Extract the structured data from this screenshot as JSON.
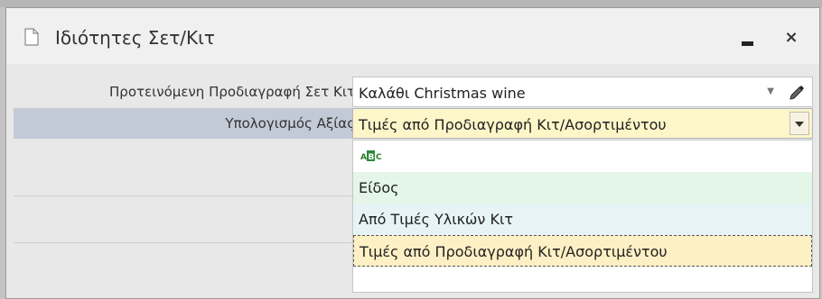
{
  "window": {
    "title": "Ιδιότητες Σετ/Κιτ",
    "close_glyph": "×"
  },
  "form": {
    "spec_label": "Προτεινόμενη Προδιαγραφή Σετ Κιτ",
    "spec_value": "Καλάθι Christmas wine",
    "value_calc_label": "Υπολογισμός Αξίας",
    "value_calc_value": "Τιμές από Προδιαγραφή Κιτ/Ασορτιμέντου"
  },
  "dropdown": {
    "search_icon_letters": "ABC",
    "options": [
      "Είδος",
      "Από Τιμές Υλικών Κιτ",
      "Τιμές από Προδιαγραφή Κιτ/Ασορτιμέντου"
    ],
    "selected_index": 2
  },
  "colors": {
    "selected_field": "#fdf6c8",
    "option_green": "#e3f6e7",
    "option_blue": "#e6f4f6",
    "option_selected": "#fdf0c4",
    "row_highlight": "#c3cad7"
  },
  "icons": {
    "title": "document-icon",
    "edit": "pencil-icon",
    "search": "abc-icon",
    "dropdown": "chevron-down-icon"
  }
}
